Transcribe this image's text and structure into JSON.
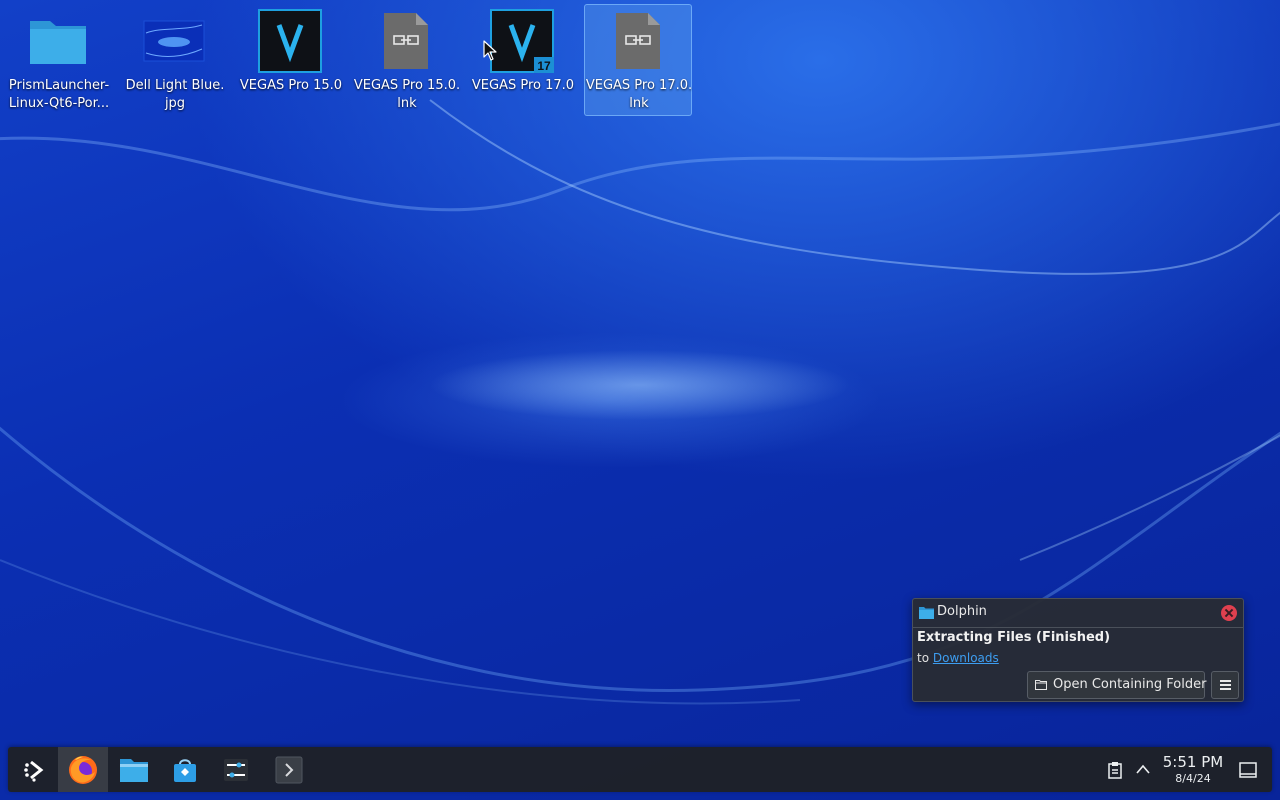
{
  "desktop": {
    "icons": [
      {
        "label": "PrismLauncher-\nLinux-Qt6-Por...",
        "icon": "folder-icon"
      },
      {
        "label": "Dell Light Blue.\njpg",
        "icon": "image-file-icon"
      },
      {
        "label": "VEGAS Pro 15.0",
        "icon": "vegas-pro-icon"
      },
      {
        "label": "VEGAS Pro 15.0.\nlnk",
        "icon": "link-file-icon"
      },
      {
        "label": "VEGAS Pro 17.0",
        "icon": "vegas-pro-17-icon",
        "badge": "17"
      },
      {
        "label": "VEGAS Pro 17.0.\nlnk",
        "icon": "link-file-icon",
        "selected": true
      }
    ]
  },
  "notification": {
    "app_name": "Dolphin",
    "title": "Extracting Files (Finished)",
    "body_prefix": "to",
    "link_text": "Downloads",
    "action_label": "Open Containing Folder",
    "link_color": "#3d9df0",
    "close_color": "#e0404f"
  },
  "taskbar": {
    "apps": [
      "application-launcher-icon",
      "firefox-icon",
      "dolphin-file-manager-icon",
      "discover-store-icon",
      "system-settings-icon",
      "konsole-terminal-icon"
    ],
    "clock_time": "5:51 PM",
    "clock_date": "8/4/24"
  }
}
